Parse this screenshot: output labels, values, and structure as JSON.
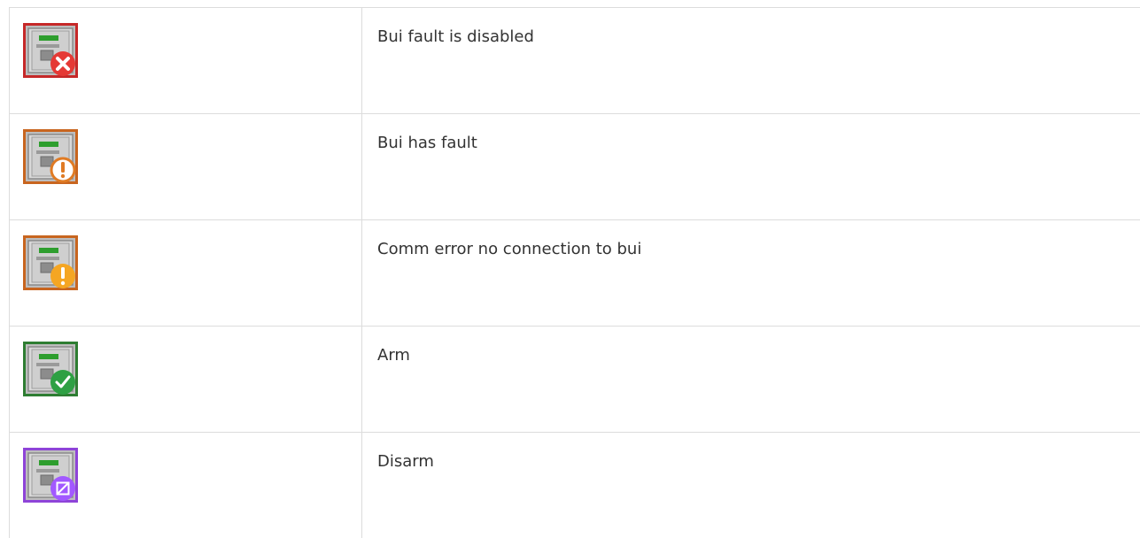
{
  "rows": [
    {
      "icon": "bui-fault-disabled-icon",
      "description": "Bui fault is disabled",
      "frame_color": "#c62828",
      "badge_color": "#e53935"
    },
    {
      "icon": "bui-has-fault-icon",
      "description": "Bui has fault",
      "frame_color": "#c8651f",
      "badge_color": "#ffffff"
    },
    {
      "icon": "bui-comm-error-icon",
      "description": "Comm error no connection to bui",
      "frame_color": "#c8651f",
      "badge_color": "#f5a623"
    },
    {
      "icon": "bui-arm-icon",
      "description": "Arm",
      "frame_color": "#2e7d32",
      "badge_color": "#2ea043"
    },
    {
      "icon": "bui-disarm-icon",
      "description": "Disarm",
      "frame_color": "#8e44d8",
      "badge_color": "#a259ff"
    }
  ]
}
